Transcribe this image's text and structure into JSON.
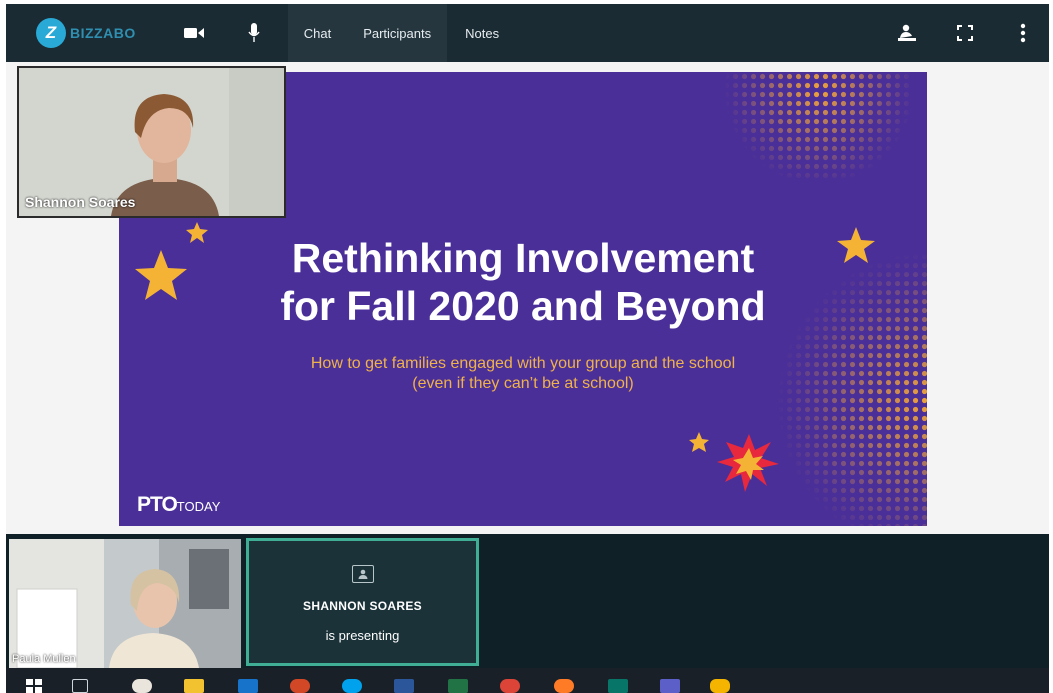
{
  "app": {
    "logo_letter": "Z",
    "logo_text": "BIZZABO"
  },
  "toolbar": {
    "camera_icon": "video-camera-icon",
    "mic_icon": "microphone-icon",
    "tabs": [
      {
        "label": "Chat",
        "active": true
      },
      {
        "label": "Participants",
        "active": true
      },
      {
        "label": "Notes",
        "active": false
      }
    ],
    "right_icons": [
      "presenter-icon",
      "fullscreen-icon",
      "more-vertical-icon"
    ]
  },
  "slide": {
    "title_line1": "Rethinking Involvement",
    "title_line2": "for Fall 2020 and Beyond",
    "subtitle_line1": "How to get families engaged with your group and the school",
    "subtitle_line2": "(even if they can’t be at school)",
    "logo_main": "PTO",
    "logo_small": "TODAY",
    "background_color": "#4a2f99",
    "accent_color": "#f0b24a"
  },
  "presenter_tile": {
    "name": "Shannon Soares"
  },
  "participants": {
    "paula_name": "Paula Mullen",
    "presenting_name": "SHANNON SOARES",
    "presenting_status": "is presenting",
    "highlight_color": "#3fae95"
  },
  "taskbar": {
    "icons": [
      "windows-start-icon",
      "task-view-icon",
      "paint-icon",
      "file-explorer-icon",
      "outlook-icon",
      "powerpoint-icon",
      "skype-icon",
      "word-icon",
      "excel-icon",
      "chrome-icon",
      "firefox-icon",
      "publisher-icon",
      "teams-icon",
      "drive-icon"
    ]
  }
}
